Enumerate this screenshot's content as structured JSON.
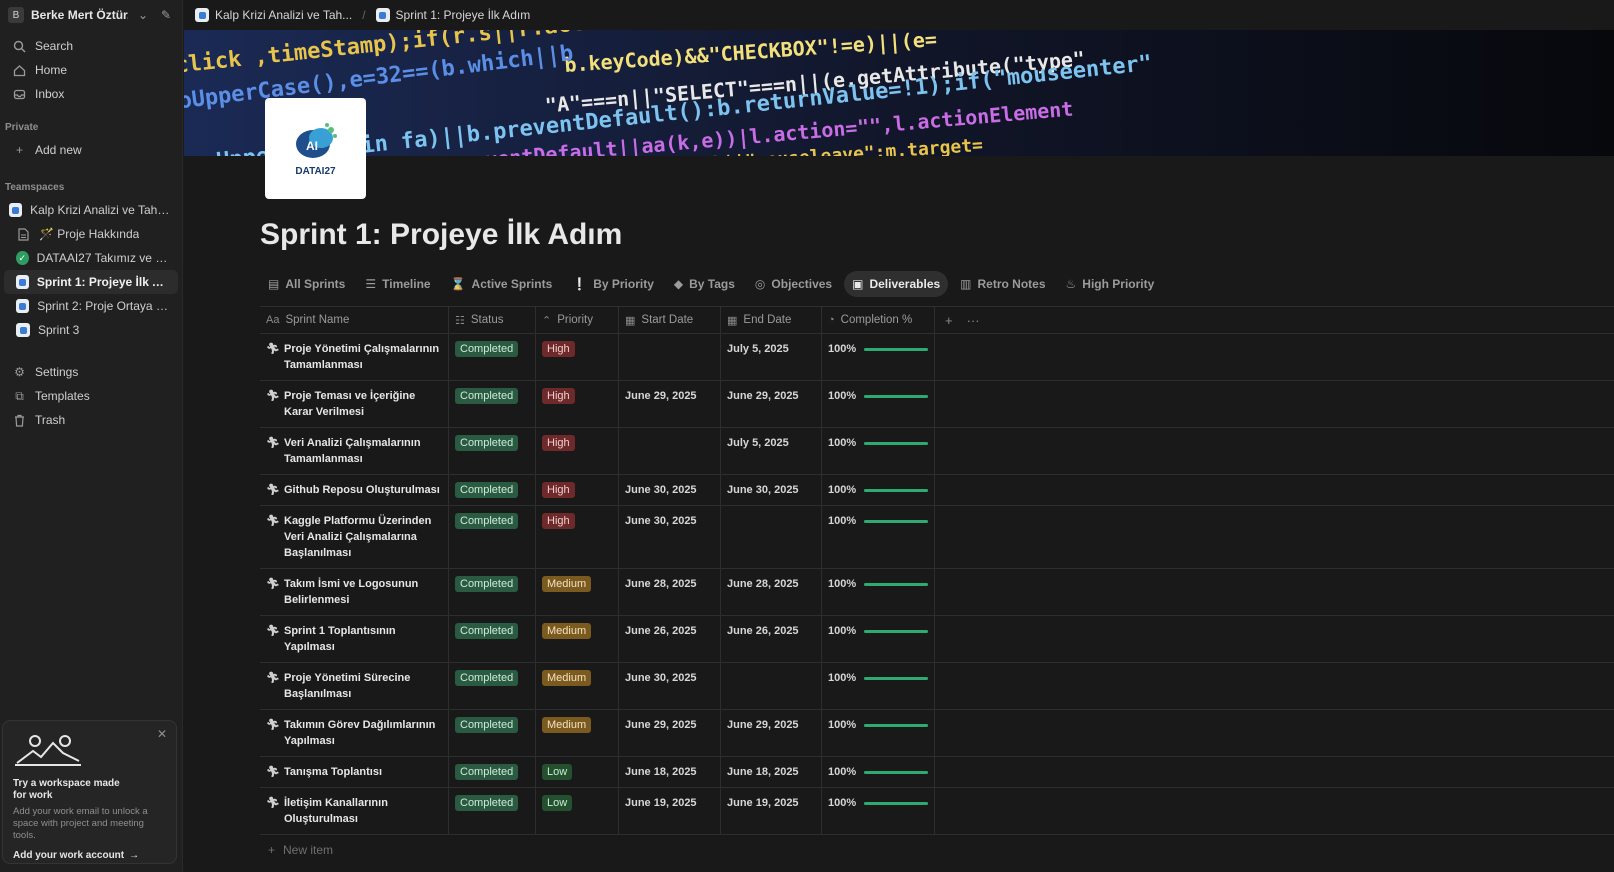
{
  "workspace": {
    "initial": "B",
    "name": "Berke Mert Öztür..."
  },
  "nav": {
    "search": "Search",
    "home": "Home",
    "inbox": "Inbox",
    "add_new": "Add new",
    "settings": "Settings",
    "templates": "Templates",
    "trash": "Trash"
  },
  "sections": {
    "private": "Private",
    "teamspaces": "Teamspaces"
  },
  "teamspace_pages": [
    {
      "label": "Kalp Krizi Analizi ve Tahmini"
    },
    {
      "label": "🪄 Proje Hakkında"
    },
    {
      "label": "DATAAI27 Takımız ve Gör..."
    },
    {
      "label": "Sprint 1: Projeye İlk Adım"
    },
    {
      "label": "Sprint 2: Proje Ortaya Çı..."
    },
    {
      "label": "Sprint 3"
    }
  ],
  "promo": {
    "title": "Try a workspace made for work",
    "text": "Add your work email to unlock a space with project and meeting tools.",
    "link": "Add your work account"
  },
  "breadcrumbs": [
    "Kalp Krizi Analizi ve Tah...",
    "Sprint 1: Projeye İlk Adım"
  ],
  "logo_text": "DATAI27",
  "page_title": "Sprint 1: Projeye İlk Adım",
  "tabs": [
    "All Sprints",
    "Timeline",
    "Active Sprints",
    "By Priority",
    "By Tags",
    "Objectives",
    "Deliverables",
    "Retro Notes",
    "High Priority"
  ],
  "columns": [
    "Sprint Name",
    "Status",
    "Priority",
    "Start Date",
    "End Date",
    "Completion %"
  ],
  "rows": [
    {
      "name": "Proje Yönetimi Çalışmalarının Tamamlanması",
      "status": "Completed",
      "priority": "High",
      "start": "",
      "end": "July 5, 2025",
      "completion": "100%",
      "completion_fraction": 1.0
    },
    {
      "name": "Proje Teması ve İçeriğine Karar Verilmesi",
      "status": "Completed",
      "priority": "High",
      "start": "June 29, 2025",
      "end": "June 29, 2025",
      "completion": "100%",
      "completion_fraction": 1.0
    },
    {
      "name": "Veri Analizi Çalışmalarının Tamamlanması",
      "status": "Completed",
      "priority": "High",
      "start": "",
      "end": "July 5, 2025",
      "completion": "100%",
      "completion_fraction": 1.0
    },
    {
      "name": "Github Reposu Oluşturulması",
      "status": "Completed",
      "priority": "High",
      "start": "June 30, 2025",
      "end": "June 30, 2025",
      "completion": "100%",
      "completion_fraction": 1.0
    },
    {
      "name": "Kaggle Platformu Üzerinden Veri Analizi Çalışmalarına Başlanılması",
      "status": "Completed",
      "priority": "High",
      "start": "June 30, 2025",
      "end": "",
      "completion": "100%",
      "completion_fraction": 1.0
    },
    {
      "name": "Takım İsmi ve Logosunun Belirlenmesi",
      "status": "Completed",
      "priority": "Medium",
      "start": "June 28, 2025",
      "end": "June 28, 2025",
      "completion": "100%",
      "completion_fraction": 1.0
    },
    {
      "name": "Sprint 1 Toplantısının Yapılması",
      "status": "Completed",
      "priority": "Medium",
      "start": "June 26, 2025",
      "end": "June 26, 2025",
      "completion": "100%",
      "completion_fraction": 1.0
    },
    {
      "name": "Proje Yönetimi Sürecine Başlanılması",
      "status": "Completed",
      "priority": "Medium",
      "start": "June 30, 2025",
      "end": "",
      "completion": "100%",
      "completion_fraction": 1.0
    },
    {
      "name": "Takımın Görev Dağılımlarının Yapılması",
      "status": "Completed",
      "priority": "Medium",
      "start": "June 29, 2025",
      "end": "June 29, 2025",
      "completion": "100%",
      "completion_fraction": 1.0
    },
    {
      "name": "Tanışma Toplantısı",
      "status": "Completed",
      "priority": "Low",
      "start": "June 18, 2025",
      "end": "June 18, 2025",
      "completion": "100%",
      "completion_fraction": 1.0
    },
    {
      "name": "İletişim Kanallarının Oluşturulması",
      "status": "Completed",
      "priority": "Low",
      "start": "June 19, 2025",
      "end": "June 19, 2025",
      "completion": "100%",
      "completion_fraction": 1.0
    }
  ],
  "new_item": "New item",
  "colors": {
    "completed": "#2b5a43",
    "high": "#6e2a2a",
    "medium": "#7a5a1f",
    "low": "#24502f",
    "progress": "#2eab73"
  }
}
